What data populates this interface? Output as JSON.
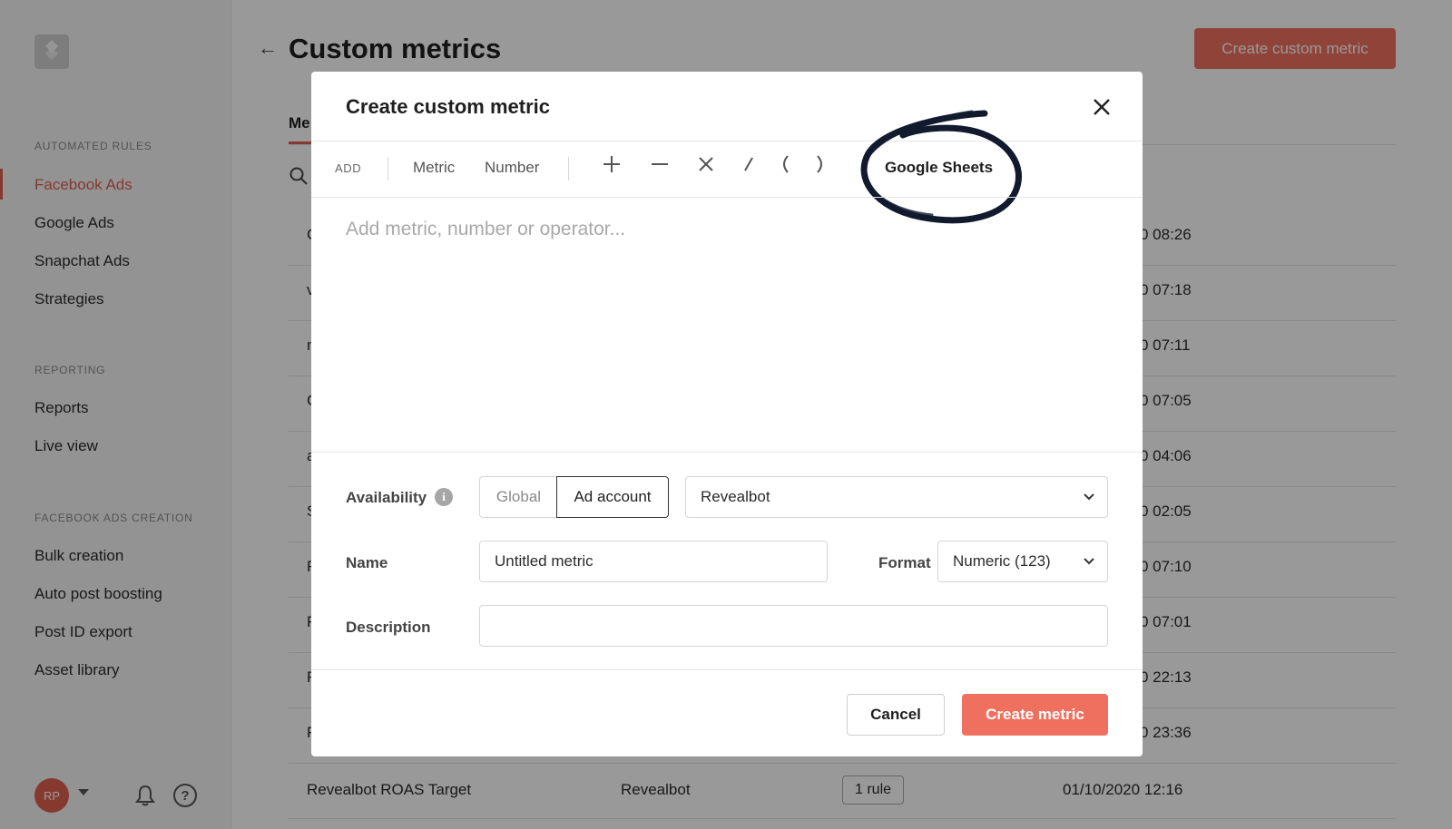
{
  "sidebar": {
    "sections": [
      {
        "title": "AUTOMATED RULES",
        "items": [
          "Facebook Ads",
          "Google Ads",
          "Snapchat Ads",
          "Strategies"
        ]
      },
      {
        "title": "REPORTING",
        "items": [
          "Reports",
          "Live view"
        ]
      },
      {
        "title": "FACEBOOK ADS CREATION",
        "items": [
          "Bulk creation",
          "Auto post boosting",
          "Post ID export",
          "Asset library"
        ]
      }
    ],
    "active_item": "Facebook Ads",
    "user_initials": "RP"
  },
  "page": {
    "title": "Custom metrics",
    "create_button": "Create custom metric",
    "tab_partial": "Me",
    "row_first_chars": [
      "C",
      "v",
      "n",
      "C",
      "a",
      "S",
      "F",
      "F",
      "F",
      "F"
    ],
    "row_dates": [
      "0 08:26",
      "0 07:18",
      "0 07:11",
      "0 07:05",
      "0 04:06",
      "0 02:05",
      "0 07:10",
      "0 07:01",
      "0 22:13",
      "0 23:36"
    ],
    "last_row": {
      "name": "Revealbot ROAS Target",
      "account": "Revealbot",
      "usage": "1 rule",
      "date": "01/10/2020 12:16"
    }
  },
  "modal": {
    "title": "Create custom metric",
    "toolbar": {
      "add_label": "ADD",
      "metric": "Metric",
      "number": "Number",
      "operators": [
        "+",
        "−",
        "×",
        "/",
        "(",
        ")"
      ],
      "google_sheets": "Google Sheets"
    },
    "formula_placeholder": "Add metric, number or operator...",
    "availability": {
      "label": "Availability",
      "options": [
        "Global",
        "Ad account"
      ],
      "selected": "Ad account",
      "account": "Revealbot"
    },
    "name": {
      "label": "Name",
      "value": "Untitled metric"
    },
    "format": {
      "label": "Format",
      "value": "Numeric (123)"
    },
    "description": {
      "label": "Description",
      "value": ""
    },
    "cancel": "Cancel",
    "submit": "Create metric"
  },
  "colors": {
    "accent": "#f0705f",
    "active_nav": "#e0604f",
    "overlay": "rgba(0,0,0,0.40)"
  }
}
